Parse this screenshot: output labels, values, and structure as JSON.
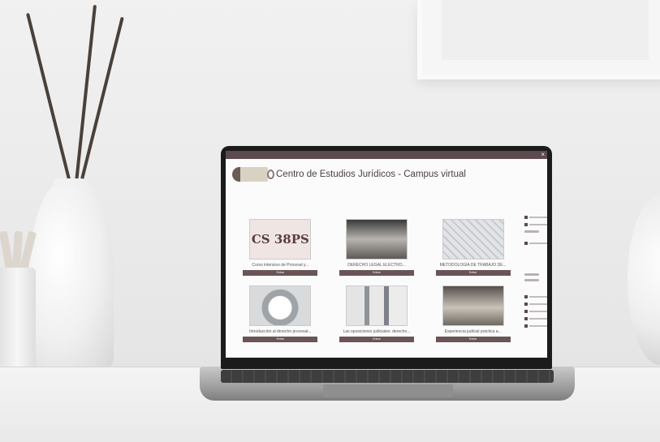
{
  "site": {
    "title": "Centro de Estudios Jurídicos - Campus virtual",
    "close_glyph": "×",
    "courses": [
      {
        "title": "Curso intensivo de Procesal y...",
        "button": "Entrar",
        "thumb_text": "CS 38PS"
      },
      {
        "title": "DERECHO LEGAL ELECTRÓ...",
        "button": "Entrar",
        "thumb_text": ""
      },
      {
        "title": "METODOLOGÍA DE TRABAJO DE...",
        "button": "Entrar",
        "thumb_text": ""
      },
      {
        "title": "Introducción al derecho procesal...",
        "button": "Entrar",
        "thumb_text": ""
      },
      {
        "title": "Las oposiciones judiciales: derecho...",
        "button": "Entrar",
        "thumb_text": ""
      },
      {
        "title": "Experiencia judicial práctica a...",
        "button": "Entrar",
        "thumb_text": ""
      }
    ],
    "accent_color": "#5b4a4e"
  }
}
